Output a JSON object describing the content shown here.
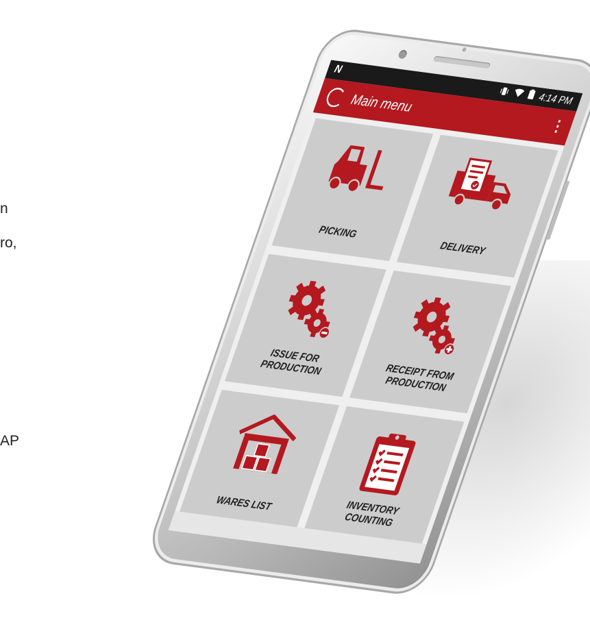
{
  "background": {
    "fragments": [
      "n",
      "ro,",
      "AP"
    ]
  },
  "status_bar": {
    "left_icon": "N",
    "time": "4:14 PM",
    "icons": [
      "vibrate-icon",
      "wifi-icon",
      "battery-icon"
    ]
  },
  "app_bar": {
    "title": "Main menu",
    "menu_icon": "⋮",
    "accent_color": "#b3191f"
  },
  "tiles": [
    {
      "label": "PICKING",
      "icon": "forklift-icon"
    },
    {
      "label": "DELIVERY",
      "icon": "truck-icon"
    },
    {
      "label": "ISSUE FOR\nPRODUCTION",
      "icon": "gears-minus-icon"
    },
    {
      "label": "RECEIPT FROM\nPRODUCTION",
      "icon": "gears-plus-icon"
    },
    {
      "label": "WARES LIST",
      "icon": "warehouse-icon"
    },
    {
      "label": "INVENTORY\nCOUNTING",
      "icon": "clipboard-checklist-icon"
    }
  ]
}
